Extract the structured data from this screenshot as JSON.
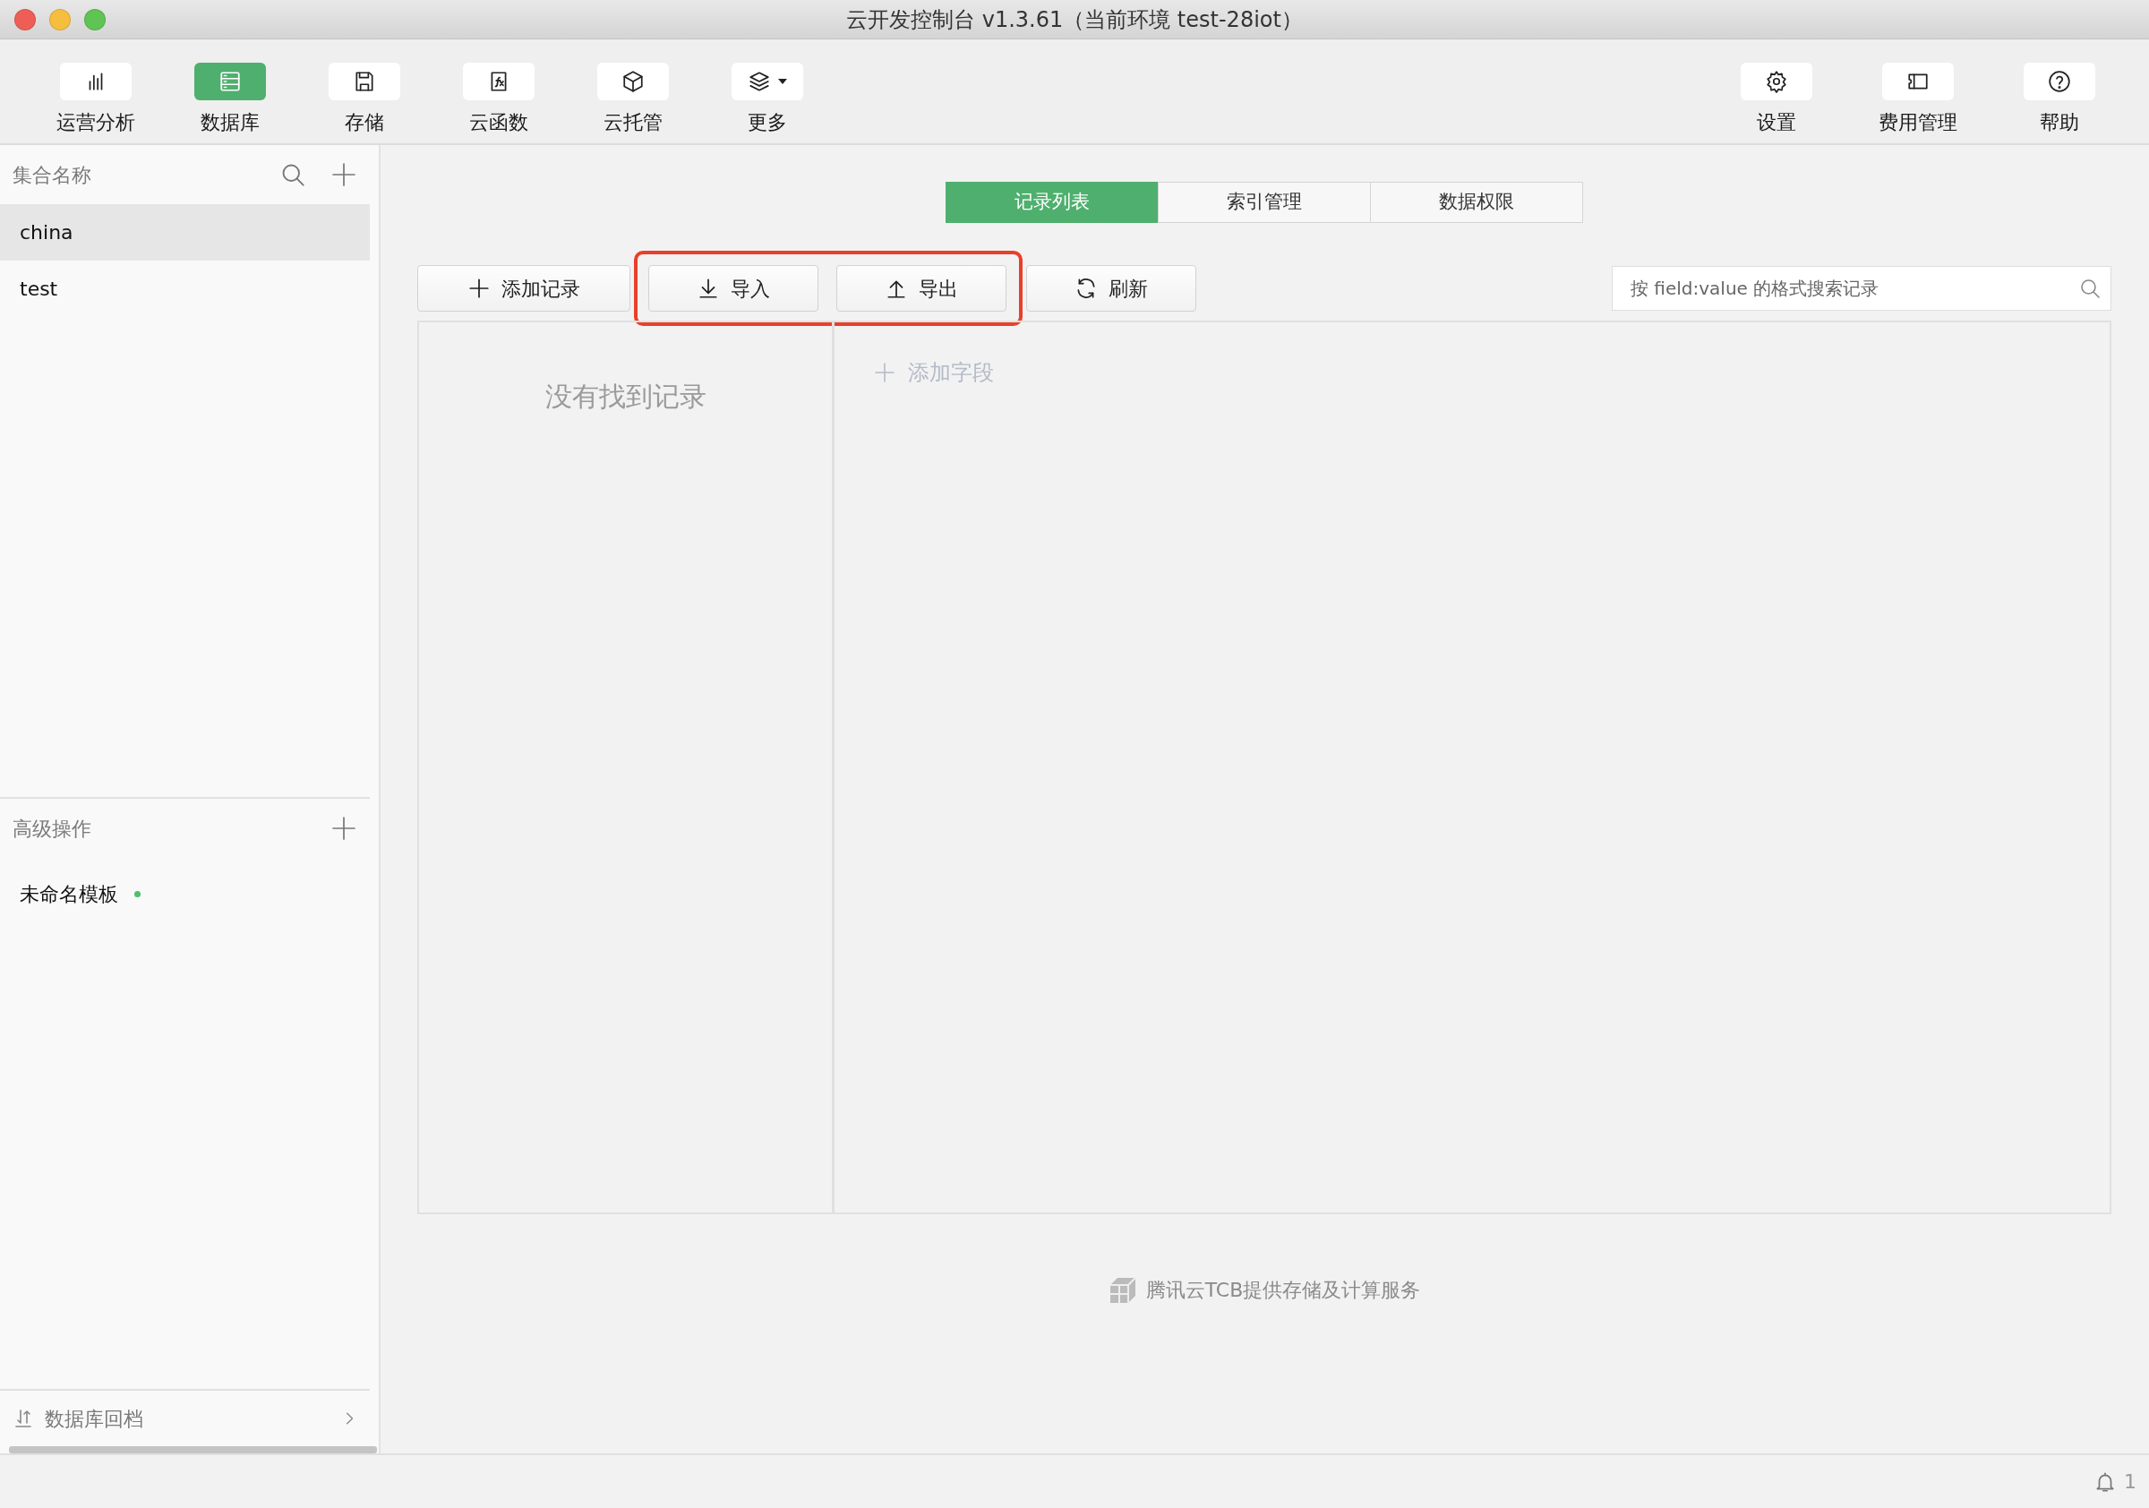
{
  "window": {
    "title": "云开发控制台 v1.3.61（当前环境 test-28iot）"
  },
  "toolbar": {
    "left": [
      {
        "label": "运营分析",
        "kind": "chart",
        "selected": false
      },
      {
        "label": "数据库",
        "kind": "database",
        "selected": true
      },
      {
        "label": "存储",
        "kind": "save",
        "selected": false
      },
      {
        "label": "云函数",
        "kind": "function",
        "selected": false
      },
      {
        "label": "云托管",
        "kind": "cube",
        "selected": false
      },
      {
        "label": "更多",
        "kind": "layers",
        "selected": false
      }
    ],
    "right": [
      {
        "label": "设置",
        "kind": "gear",
        "selected": false
      },
      {
        "label": "费用管理",
        "kind": "ticket",
        "selected": false
      },
      {
        "label": "帮助",
        "kind": "help",
        "selected": false
      }
    ]
  },
  "sidebar": {
    "collections_header": "集合名称",
    "collections": [
      {
        "name": "china",
        "selected": true
      },
      {
        "name": "test",
        "selected": false
      }
    ],
    "advanced_header": "高级操作",
    "templates": [
      {
        "name": "未命名模板",
        "unsaved": true
      }
    ],
    "backup_link": "数据库回档"
  },
  "tabs": [
    {
      "label": "记录列表",
      "selected": true
    },
    {
      "label": "索引管理",
      "selected": false
    },
    {
      "label": "数据权限",
      "selected": false
    }
  ],
  "actions": [
    {
      "label": "添加记录",
      "kind": "add",
      "highlighted": false
    },
    {
      "label": "导入",
      "kind": "import",
      "highlighted": true
    },
    {
      "label": "导出",
      "kind": "export",
      "highlighted": true
    },
    {
      "label": "刷新",
      "kind": "refresh",
      "highlighted": false
    }
  ],
  "search": {
    "placeholder": "按 field:value 的格式搜索记录"
  },
  "records": {
    "empty_message": "没有找到记录",
    "add_field": "添加字段"
  },
  "footer": {
    "text": "腾讯云TCB提供存储及计算服务"
  },
  "status_bar": {
    "notifications": "1"
  }
}
